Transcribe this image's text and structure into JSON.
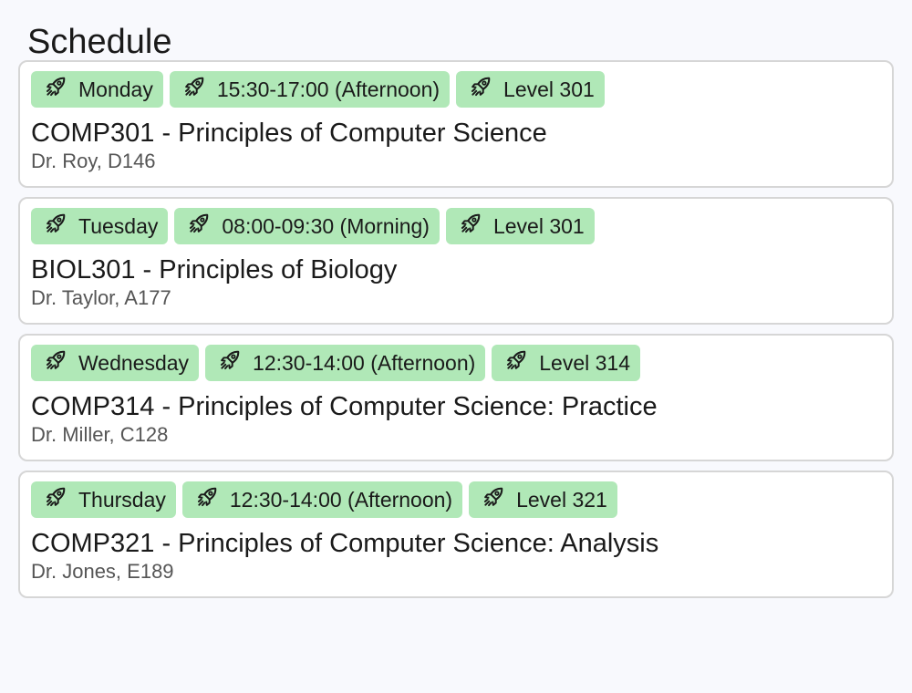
{
  "page": {
    "title": "Schedule"
  },
  "schedule": [
    {
      "day": "Monday",
      "time": "15:30-17:00 (Afternoon)",
      "level": "Level 301",
      "course": "COMP301 - Principles of Computer Science",
      "details": "Dr. Roy, D146"
    },
    {
      "day": "Tuesday",
      "time": "08:00-09:30 (Morning)",
      "level": "Level 301",
      "course": "BIOL301 - Principles of Biology",
      "details": "Dr. Taylor, A177"
    },
    {
      "day": "Wednesday",
      "time": "12:30-14:00 (Afternoon)",
      "level": "Level 314",
      "course": "COMP314 - Principles of Computer Science: Practice",
      "details": "Dr. Miller, C128"
    },
    {
      "day": "Thursday",
      "time": "12:30-14:00 (Afternoon)",
      "level": "Level 321",
      "course": "COMP321 - Principles of Computer Science: Analysis",
      "details": "Dr. Jones, E189"
    }
  ],
  "icons": {
    "tag_icon": "rocket-icon"
  },
  "colors": {
    "tag_background": "#b0e8b7",
    "card_border": "#d6d6d6",
    "page_background": "#f8f9fd",
    "meta_text": "#555555"
  }
}
